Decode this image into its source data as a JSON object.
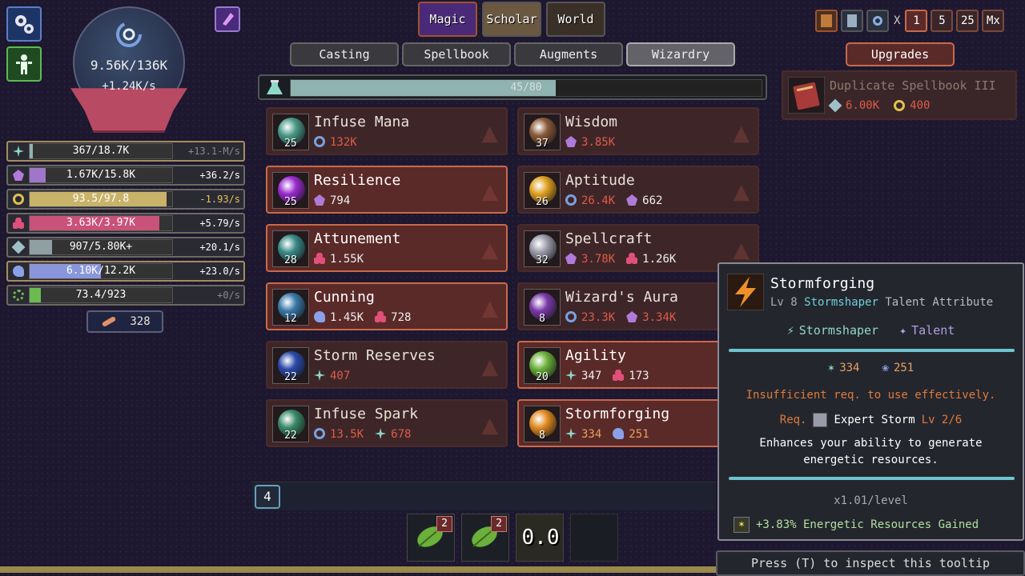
{
  "left_buttons": [
    {
      "icon": "gears-icon"
    },
    {
      "icon": "wizard-figure-icon"
    }
  ],
  "mana_orb": {
    "value": "9.56K/136K",
    "rate": "+1.24K/s"
  },
  "resources": [
    {
      "icon": "energy-spark-icon",
      "text": "367/18.7K",
      "rate": "+13.1-M/s",
      "rate_color": "#8a8a8a",
      "fill": 0.02,
      "bar_color": "#8fb3b0",
      "active": true
    },
    {
      "icon": "purple-rune-icon",
      "text": "1.67K/15.8K",
      "rate": "+36.2/s",
      "rate_color": "#ffffff",
      "fill": 0.11,
      "bar_color": "#9f76c9",
      "active": false
    },
    {
      "icon": "gold-ring-icon",
      "text": "93.5/97.8",
      "rate": "-1.93/s",
      "rate_color": "#e8c062",
      "fill": 0.96,
      "bar_color": "#c9b36a",
      "active": false
    },
    {
      "icon": "pink-trefoil-icon",
      "text": "3.63K/3.97K",
      "rate": "+5.79/s",
      "rate_color": "#ffffff",
      "fill": 0.91,
      "bar_color": "#c9527a",
      "active": false
    },
    {
      "icon": "ice-cube-icon",
      "text": "907/5.80K+",
      "rate": "+20.1/s",
      "rate_color": "#ffffff",
      "fill": 0.16,
      "bar_color": "#8fa0a5",
      "active": false
    },
    {
      "icon": "blue-flower-icon",
      "text": "6.10K/12.2K",
      "rate": "+23.0/s",
      "rate_color": "#ffffff",
      "fill": 0.5,
      "bar_color": "#8a96d9",
      "active": true
    },
    {
      "icon": "green-gear-icon",
      "text": "73.4/923",
      "rate": "+0/s",
      "rate_color": "#8a8a8a",
      "fill": 0.08,
      "bar_color": "#6bbb52",
      "active": false
    }
  ],
  "scroll": {
    "count": "328"
  },
  "top_tabs": [
    "Magic",
    "Scholar",
    "World"
  ],
  "sub_tabs": [
    "Casting",
    "Spellbook",
    "Augments",
    "Wizardry"
  ],
  "selected_sub_tab": "Wizardry",
  "progress": {
    "text": "45/80",
    "fraction": 0.5625
  },
  "cards": [
    {
      "name": "Infuse Mana",
      "level": "25",
      "gem_color": "#4a9a88",
      "costs": [
        {
          "icon": "mana-swirl-icon",
          "value": "132K",
          "color": "#e05a48",
          "icon_color": "#7aa0e0"
        }
      ],
      "selected": false
    },
    {
      "name": "Wisdom",
      "level": "37",
      "gem_color": "#8a5a3a",
      "costs": [
        {
          "icon": "purple-rune-icon",
          "value": "3.85K",
          "color": "#e05a48",
          "icon_color": "#b07ad9"
        }
      ],
      "selected": false
    },
    {
      "name": "Resilience",
      "level": "25",
      "gem_color": "#9a2ad0",
      "costs": [
        {
          "icon": "purple-rune-icon",
          "value": "794",
          "color": "#eeeeee",
          "icon_color": "#b07ad9"
        }
      ],
      "selected": true
    },
    {
      "name": "Aptitude",
      "level": "26",
      "gem_color": "#e0a020",
      "costs": [
        {
          "icon": "mana-swirl-icon",
          "value": "26.4K",
          "color": "#e05a48",
          "icon_color": "#7aa0e0"
        },
        {
          "icon": "purple-rune-icon",
          "value": "662",
          "color": "#eeeeee",
          "icon_color": "#b07ad9"
        }
      ],
      "selected": false
    },
    {
      "name": "Attunement",
      "level": "28",
      "gem_color": "#3a8a88",
      "costs": [
        {
          "icon": "pink-trefoil-icon",
          "value": "1.55K",
          "color": "#eeeeee",
          "icon_color": "#e0507a"
        }
      ],
      "selected": true
    },
    {
      "name": "Spellcraft",
      "level": "32",
      "gem_color": "#9a9aaa",
      "costs": [
        {
          "icon": "purple-rune-icon",
          "value": "3.78K",
          "color": "#e05a48",
          "icon_color": "#b07ad9"
        },
        {
          "icon": "pink-trefoil-icon",
          "value": "1.26K",
          "color": "#eeeeee",
          "icon_color": "#e0507a"
        }
      ],
      "selected": false
    },
    {
      "name": "Cunning",
      "level": "12",
      "gem_color": "#3a7aaa",
      "costs": [
        {
          "icon": "blue-flower-icon",
          "value": "1.45K",
          "color": "#eeeeee",
          "icon_color": "#8aa0e8"
        },
        {
          "icon": "pink-trefoil-icon",
          "value": "728",
          "color": "#eeeeee",
          "icon_color": "#e0507a"
        }
      ],
      "selected": true
    },
    {
      "name": "Wizard's Aura",
      "level": "8",
      "gem_color": "#7a3aaa",
      "costs": [
        {
          "icon": "mana-swirl-icon",
          "value": "23.3K",
          "color": "#e05a48",
          "icon_color": "#7aa0e0"
        },
        {
          "icon": "purple-rune-icon",
          "value": "3.34K",
          "color": "#e05a48",
          "icon_color": "#b07ad9"
        }
      ],
      "selected": false
    },
    {
      "name": "Storm Reserves",
      "level": "22",
      "gem_color": "#2a4aaa",
      "costs": [
        {
          "icon": "energy-spark-icon",
          "value": "407",
          "color": "#e05a48",
          "icon_color": "#8fd8c8"
        }
      ],
      "selected": false
    },
    {
      "name": "Agility",
      "level": "20",
      "gem_color": "#6ab03a",
      "costs": [
        {
          "icon": "energy-spark-icon",
          "value": "347",
          "color": "#eeeeee",
          "icon_color": "#8fd8c8"
        },
        {
          "icon": "pink-trefoil-icon",
          "value": "173",
          "color": "#eeeeee",
          "icon_color": "#e0507a"
        }
      ],
      "selected": true
    },
    {
      "name": "Infuse Spark",
      "level": "22",
      "gem_color": "#3a8a6a",
      "costs": [
        {
          "icon": "mana-swirl-icon",
          "value": "13.5K",
          "color": "#e05a48",
          "icon_color": "#7aa0e0"
        },
        {
          "icon": "energy-spark-icon",
          "value": "678",
          "color": "#e05a48",
          "icon_color": "#8fd8c8"
        }
      ],
      "selected": false
    },
    {
      "name": "Stormforging",
      "level": "8",
      "gem_color": "#e08a20",
      "costs": [
        {
          "icon": "energy-spark-icon",
          "value": "334",
          "color": "#e8a060",
          "icon_color": "#8fd8c8"
        },
        {
          "icon": "blue-flower-icon",
          "value": "251",
          "color": "#e8a060",
          "icon_color": "#8aa0e8"
        }
      ],
      "selected": true
    }
  ],
  "top_right": {
    "icons": [
      "spellbook-icon",
      "scroll-icon",
      "magnifier-icon"
    ],
    "multiplier_label": "X",
    "multipliers": [
      "1",
      "5",
      "25",
      "Mx"
    ],
    "selected_multiplier": "1"
  },
  "upgrades": {
    "button": "Upgrades",
    "item": {
      "name": "Duplicate Spellbook III",
      "costs": [
        {
          "icon": "ice-cube-icon",
          "value": "6.00K",
          "color": "#e05a48"
        },
        {
          "icon": "gold-ring-icon",
          "value": "400",
          "color": "#e05a48"
        }
      ]
    }
  },
  "tooltip": {
    "title": "Stormforging",
    "subtitle_prefix": "Lv 8",
    "subtitle_class": "Stormshaper",
    "subtitle_rest": "Talent Attribute",
    "tags": [
      "Stormshaper",
      "Talent"
    ],
    "costs": [
      "334",
      "251"
    ],
    "warning": "Insufficient req. to use effectively.",
    "req_label": "Req.",
    "req_name": "Expert Storm",
    "req_level": "Lv 2/6",
    "desc_line1": "Enhances your ability to generate",
    "desc_line2": "energetic resources.",
    "per_level": "x1.01/level",
    "bonus": "+3.83% Energetic Resources Gained"
  },
  "hotbar": {
    "badge": "4",
    "slots": [
      {
        "count": "2"
      },
      {
        "count": "2"
      },
      {
        "timer": "0.0"
      }
    ]
  },
  "press_hint": "Press (T) to inspect this tooltip"
}
